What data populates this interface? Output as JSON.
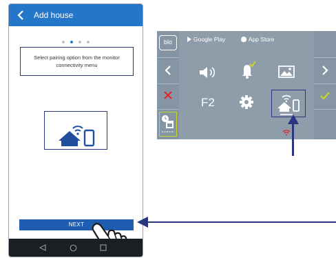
{
  "phone": {
    "title": "Add house",
    "hint": "Select pairing option from the monitor connectivity menu",
    "next_label": "NEXT",
    "step_dots": 4,
    "active_step": 2
  },
  "monitor": {
    "brand_logo": "bloo-logo",
    "google_play": "Google Play",
    "app_store": "App Store",
    "f2_label": "F2",
    "colors": {
      "panel": "#8e9da9",
      "accent_check": "#c8d62a",
      "cancel_red": "#e0232a",
      "highlight": "#2a3480"
    }
  },
  "icons": {
    "phone": [
      "chevron-left-icon",
      "house-wifi-phone-icon",
      "android-back-icon",
      "android-home-icon",
      "android-recent-icon",
      "hand-pointer-icon"
    ],
    "monitor": [
      "chevron-left-icon",
      "chevron-right-icon",
      "close-icon",
      "check-icon",
      "calendar-clock-icon",
      "volume-icon",
      "bell-icon",
      "image-icon",
      "gear-icon",
      "house-wifi-phone-icon",
      "wifi-signal-icon"
    ]
  }
}
